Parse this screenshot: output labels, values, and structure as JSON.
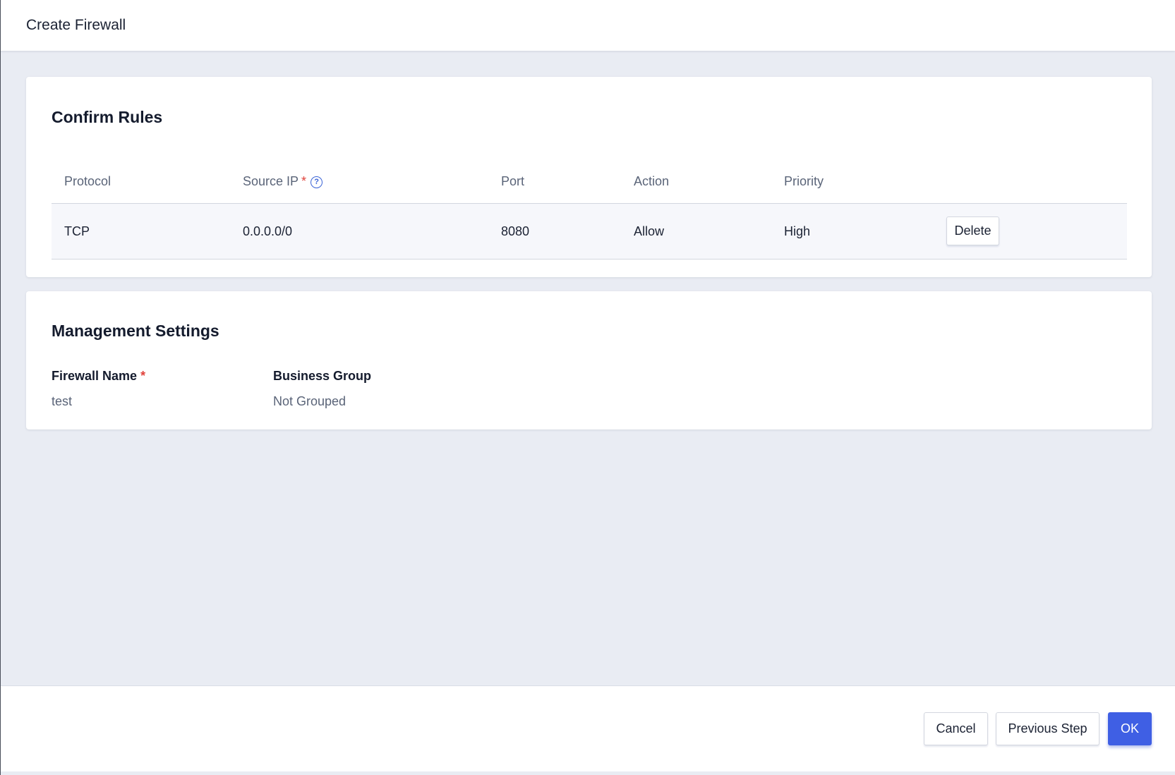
{
  "header": {
    "title": "Create Firewall"
  },
  "rules_section": {
    "title": "Confirm Rules",
    "columns": {
      "protocol": "Protocol",
      "source_ip": "Source IP",
      "source_ip_required_mark": "*",
      "source_ip_help_icon": "help-circle-icon",
      "port": "Port",
      "action": "Action",
      "priority": "Priority"
    },
    "rows": [
      {
        "protocol": "TCP",
        "source_ip": "0.0.0.0/0",
        "port": "8080",
        "action": "Allow",
        "priority": "High",
        "delete_label": "Delete"
      }
    ]
  },
  "management_section": {
    "title": "Management Settings",
    "firewall_name_label": "Firewall Name",
    "firewall_name_required_mark": "*",
    "firewall_name_value": "test",
    "business_group_label": "Business Group",
    "business_group_value": "Not Grouped"
  },
  "footer": {
    "cancel_label": "Cancel",
    "previous_label": "Previous Step",
    "ok_label": "OK"
  },
  "colors": {
    "primary": "#3f5fe4",
    "required": "#e0433c",
    "background": "#e9ecf3"
  }
}
